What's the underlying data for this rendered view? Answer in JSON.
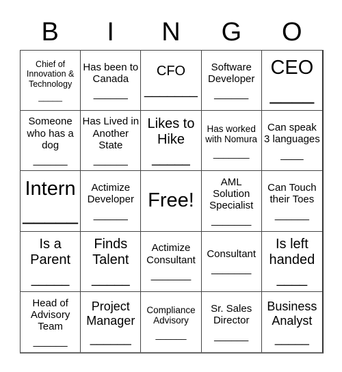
{
  "header": {
    "letters": [
      "B",
      "I",
      "N",
      "G",
      "O"
    ]
  },
  "cells": [
    {
      "text": "Chief of Innovation & Technology",
      "blank": "_____"
    },
    {
      "text": "Has been to Canada",
      "blank": "______"
    },
    {
      "text": "CFO",
      "blank": "_______"
    },
    {
      "text": "Software Developer",
      "blank": "______"
    },
    {
      "text": "CEO",
      "blank": "____"
    },
    {
      "text": "Someone who has a dog",
      "blank": "______"
    },
    {
      "text": "Has Lived in Another State",
      "blank": "______"
    },
    {
      "text": "Likes to Hike",
      "blank": "_____"
    },
    {
      "text": "Has worked with Nomura",
      "blank": "_______"
    },
    {
      "text": "Can speak 3 languages",
      "blank": "____"
    },
    {
      "text": "Intern",
      "blank": "_____"
    },
    {
      "text": "Actimize Developer",
      "blank": "______"
    },
    {
      "text": "Free!",
      "blank": ""
    },
    {
      "text": "AML Solution Specialist",
      "blank": "_______"
    },
    {
      "text": "Can Touch their Toes",
      "blank": "______"
    },
    {
      "text": "Is a Parent",
      "blank": "_____"
    },
    {
      "text": "Finds Talent",
      "blank": "_____"
    },
    {
      "text": "Actimize Consultant",
      "blank": "_______"
    },
    {
      "text": "Consultant",
      "blank": "_______"
    },
    {
      "text": "Is left handed",
      "blank": "____"
    },
    {
      "text": "Head of Advisory Team",
      "blank": "______"
    },
    {
      "text": "Project Manager",
      "blank": "______"
    },
    {
      "text": "Compliance Advisory",
      "blank": "______"
    },
    {
      "text": "Sr. Sales Director",
      "blank": "______"
    },
    {
      "text": "Business Analyst",
      "blank": "_____"
    }
  ]
}
